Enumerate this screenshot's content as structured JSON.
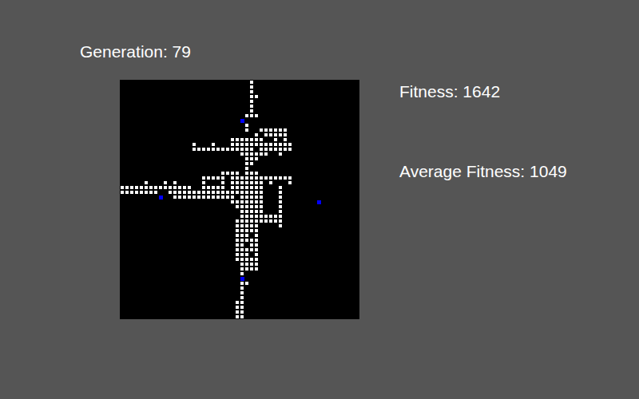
{
  "generation": {
    "label": "Generation: 79"
  },
  "fitness": {
    "label": "Fitness: 1642"
  },
  "average_fitness": {
    "label": "Average Fitness: 1049"
  },
  "grid": {
    "columns": 50,
    "rows": 50,
    "runs": [
      [
        0,
        27,
        27
      ],
      [
        1,
        27,
        27
      ],
      [
        2,
        27,
        27
      ],
      [
        3,
        27,
        28
      ],
      [
        4,
        27,
        27
      ],
      [
        5,
        27,
        27
      ],
      [
        6,
        27,
        27
      ],
      [
        7,
        26,
        28
      ],
      [
        9,
        26,
        26
      ],
      [
        10,
        26,
        26
      ],
      [
        10,
        29,
        34
      ],
      [
        11,
        28,
        28
      ],
      [
        11,
        30,
        34
      ],
      [
        12,
        23,
        29
      ],
      [
        12,
        32,
        32
      ],
      [
        12,
        34,
        34
      ],
      [
        13,
        15,
        15
      ],
      [
        13,
        19,
        19
      ],
      [
        13,
        23,
        35
      ],
      [
        14,
        15,
        27
      ],
      [
        14,
        29,
        35
      ],
      [
        15,
        25,
        30
      ],
      [
        15,
        33,
        33
      ],
      [
        16,
        26,
        28
      ],
      [
        17,
        26,
        27
      ],
      [
        18,
        26,
        26
      ],
      [
        19,
        21,
        24
      ],
      [
        19,
        26,
        28
      ],
      [
        20,
        17,
        21
      ],
      [
        20,
        23,
        35
      ],
      [
        21,
        5,
        5
      ],
      [
        21,
        9,
        9
      ],
      [
        21,
        11,
        11
      ],
      [
        21,
        17,
        17
      ],
      [
        21,
        21,
        21
      ],
      [
        21,
        23,
        29
      ],
      [
        21,
        31,
        31
      ],
      [
        21,
        35,
        35
      ],
      [
        22,
        0,
        14
      ],
      [
        22,
        17,
        21
      ],
      [
        22,
        23,
        29
      ],
      [
        22,
        33,
        33
      ],
      [
        23,
        0,
        7
      ],
      [
        23,
        10,
        29
      ],
      [
        23,
        33,
        33
      ],
      [
        24,
        11,
        23
      ],
      [
        24,
        25,
        29
      ],
      [
        24,
        33,
        33
      ],
      [
        25,
        23,
        29
      ],
      [
        25,
        33,
        33
      ],
      [
        26,
        24,
        29
      ],
      [
        26,
        33,
        33
      ],
      [
        27,
        25,
        29
      ],
      [
        27,
        33,
        33
      ],
      [
        28,
        25,
        33
      ],
      [
        29,
        24,
        33
      ],
      [
        30,
        24,
        28
      ],
      [
        30,
        33,
        33
      ],
      [
        31,
        24,
        28
      ],
      [
        32,
        24,
        26
      ],
      [
        32,
        28,
        28
      ],
      [
        33,
        24,
        28
      ],
      [
        34,
        24,
        25
      ],
      [
        34,
        27,
        28
      ],
      [
        35,
        24,
        28
      ],
      [
        36,
        24,
        26
      ],
      [
        36,
        28,
        28
      ],
      [
        37,
        24,
        28
      ],
      [
        38,
        25,
        28
      ],
      [
        39,
        25,
        28
      ],
      [
        40,
        25,
        25
      ],
      [
        42,
        25,
        26
      ],
      [
        43,
        25,
        25
      ],
      [
        44,
        25,
        25
      ],
      [
        45,
        25,
        25
      ],
      [
        46,
        24,
        25
      ],
      [
        47,
        24,
        25
      ],
      [
        48,
        24,
        25
      ],
      [
        49,
        24,
        25
      ]
    ]
  },
  "agents": [
    {
      "col": 25,
      "row": 8,
      "color": "#0000ff"
    },
    {
      "col": 8,
      "row": 24,
      "color": "#0000ff"
    },
    {
      "col": 41,
      "row": 25,
      "color": "#0000ff"
    },
    {
      "col": 25,
      "row": 41,
      "color": "#0000ff"
    }
  ]
}
